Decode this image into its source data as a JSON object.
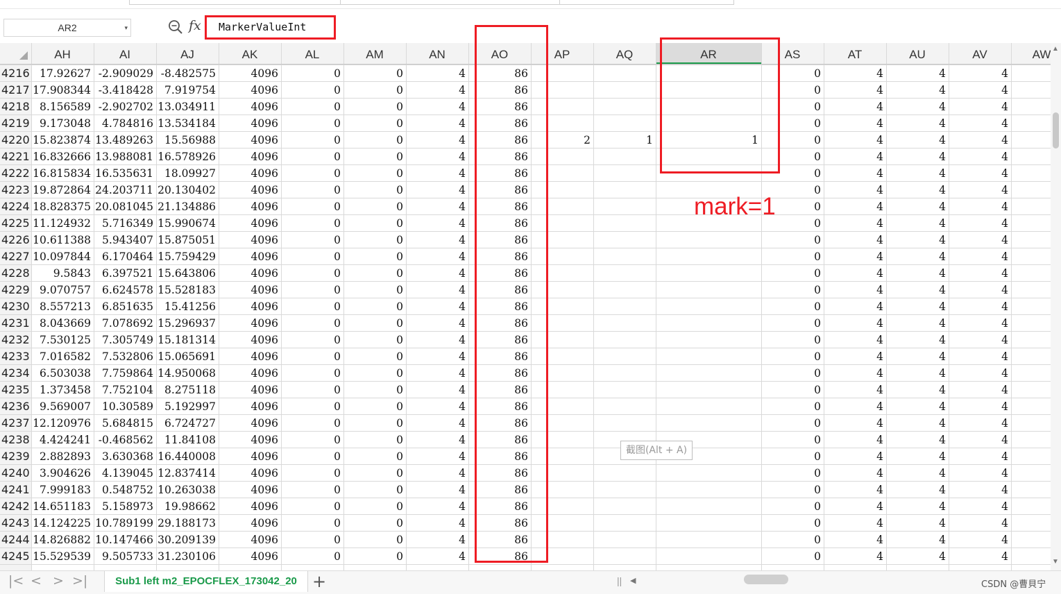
{
  "name_box": {
    "value": "AR2"
  },
  "formula_bar": {
    "fx_label": "fx",
    "content": "MarkerValueInt"
  },
  "columns": [
    "AH",
    "AI",
    "AJ",
    "AK",
    "AL",
    "AM",
    "AN",
    "AO",
    "AP",
    "AQ",
    "AR",
    "AS",
    "AT",
    "AU",
    "AV",
    "AW"
  ],
  "selected_column": "AR",
  "rows": [
    {
      "n": "4216",
      "v": [
        "17.92627",
        "-2.909029",
        "-8.482575",
        "4096",
        "0",
        "0",
        "4",
        "86",
        "",
        "",
        "",
        "0",
        "4",
        "4",
        "4"
      ]
    },
    {
      "n": "4217",
      "v": [
        "17.908344",
        "-3.418428",
        "7.919754",
        "4096",
        "0",
        "0",
        "4",
        "86",
        "",
        "",
        "",
        "0",
        "4",
        "4",
        "4"
      ]
    },
    {
      "n": "4218",
      "v": [
        "8.156589",
        "-2.902702",
        "13.034911",
        "4096",
        "0",
        "0",
        "4",
        "86",
        "",
        "",
        "",
        "0",
        "4",
        "4",
        "4"
      ]
    },
    {
      "n": "4219",
      "v": [
        "9.173048",
        "4.784816",
        "13.534184",
        "4096",
        "0",
        "0",
        "4",
        "86",
        "",
        "",
        "",
        "0",
        "4",
        "4",
        "4"
      ]
    },
    {
      "n": "4220",
      "v": [
        "15.823874",
        "13.489263",
        "15.56988",
        "4096",
        "0",
        "0",
        "4",
        "86",
        "2",
        "1",
        "1",
        "0",
        "4",
        "4",
        "4"
      ]
    },
    {
      "n": "4221",
      "v": [
        "16.832666",
        "13.988081",
        "16.578926",
        "4096",
        "0",
        "0",
        "4",
        "86",
        "",
        "",
        "",
        "0",
        "4",
        "4",
        "4"
      ]
    },
    {
      "n": "4222",
      "v": [
        "16.815834",
        "16.535631",
        "18.09927",
        "4096",
        "0",
        "0",
        "4",
        "86",
        "",
        "",
        "",
        "0",
        "4",
        "4",
        "4"
      ]
    },
    {
      "n": "4223",
      "v": [
        "19.872864",
        "24.203711",
        "20.130402",
        "4096",
        "0",
        "0",
        "4",
        "86",
        "",
        "",
        "",
        "0",
        "4",
        "4",
        "4"
      ]
    },
    {
      "n": "4224",
      "v": [
        "18.828375",
        "20.081045",
        "21.134886",
        "4096",
        "0",
        "0",
        "4",
        "86",
        "",
        "",
        "",
        "0",
        "4",
        "4",
        "4"
      ]
    },
    {
      "n": "4225",
      "v": [
        "11.124932",
        "5.716349",
        "15.990674",
        "4096",
        "0",
        "0",
        "4",
        "86",
        "",
        "",
        "",
        "0",
        "4",
        "4",
        "4"
      ]
    },
    {
      "n": "4226",
      "v": [
        "10.611388",
        "5.943407",
        "15.875051",
        "4096",
        "0",
        "0",
        "4",
        "86",
        "",
        "",
        "",
        "0",
        "4",
        "4",
        "4"
      ]
    },
    {
      "n": "4227",
      "v": [
        "10.097844",
        "6.170464",
        "15.759429",
        "4096",
        "0",
        "0",
        "4",
        "86",
        "",
        "",
        "",
        "0",
        "4",
        "4",
        "4"
      ]
    },
    {
      "n": "4228",
      "v": [
        "9.5843",
        "6.397521",
        "15.643806",
        "4096",
        "0",
        "0",
        "4",
        "86",
        "",
        "",
        "",
        "0",
        "4",
        "4",
        "4"
      ]
    },
    {
      "n": "4229",
      "v": [
        "9.070757",
        "6.624578",
        "15.528183",
        "4096",
        "0",
        "0",
        "4",
        "86",
        "",
        "",
        "",
        "0",
        "4",
        "4",
        "4"
      ]
    },
    {
      "n": "4230",
      "v": [
        "8.557213",
        "6.851635",
        "15.41256",
        "4096",
        "0",
        "0",
        "4",
        "86",
        "",
        "",
        "",
        "0",
        "4",
        "4",
        "4"
      ]
    },
    {
      "n": "4231",
      "v": [
        "8.043669",
        "7.078692",
        "15.296937",
        "4096",
        "0",
        "0",
        "4",
        "86",
        "",
        "",
        "",
        "0",
        "4",
        "4",
        "4"
      ]
    },
    {
      "n": "4232",
      "v": [
        "7.530125",
        "7.305749",
        "15.181314",
        "4096",
        "0",
        "0",
        "4",
        "86",
        "",
        "",
        "",
        "0",
        "4",
        "4",
        "4"
      ]
    },
    {
      "n": "4233",
      "v": [
        "7.016582",
        "7.532806",
        "15.065691",
        "4096",
        "0",
        "0",
        "4",
        "86",
        "",
        "",
        "",
        "0",
        "4",
        "4",
        "4"
      ]
    },
    {
      "n": "4234",
      "v": [
        "6.503038",
        "7.759864",
        "14.950068",
        "4096",
        "0",
        "0",
        "4",
        "86",
        "",
        "",
        "",
        "0",
        "4",
        "4",
        "4"
      ]
    },
    {
      "n": "4235",
      "v": [
        "1.373458",
        "7.752104",
        "8.275118",
        "4096",
        "0",
        "0",
        "4",
        "86",
        "",
        "",
        "",
        "0",
        "4",
        "4",
        "4"
      ]
    },
    {
      "n": "4236",
      "v": [
        "9.569007",
        "10.30589",
        "5.192997",
        "4096",
        "0",
        "0",
        "4",
        "86",
        "",
        "",
        "",
        "0",
        "4",
        "4",
        "4"
      ]
    },
    {
      "n": "4237",
      "v": [
        "12.120976",
        "5.684815",
        "6.724727",
        "4096",
        "0",
        "0",
        "4",
        "86",
        "",
        "",
        "",
        "0",
        "4",
        "4",
        "4"
      ]
    },
    {
      "n": "4238",
      "v": [
        "4.424241",
        "-0.468562",
        "11.84108",
        "4096",
        "0",
        "0",
        "4",
        "86",
        "",
        "",
        "",
        "0",
        "4",
        "4",
        "4"
      ]
    },
    {
      "n": "4239",
      "v": [
        "2.882893",
        "3.630368",
        "16.440008",
        "4096",
        "0",
        "0",
        "4",
        "86",
        "",
        "",
        "",
        "0",
        "4",
        "4",
        "4"
      ]
    },
    {
      "n": "4240",
      "v": [
        "3.904626",
        "4.139045",
        "12.837414",
        "4096",
        "0",
        "0",
        "4",
        "86",
        "",
        "",
        "",
        "0",
        "4",
        "4",
        "4"
      ]
    },
    {
      "n": "4241",
      "v": [
        "7.999183",
        "0.548752",
        "10.263038",
        "4096",
        "0",
        "0",
        "4",
        "86",
        "",
        "",
        "",
        "0",
        "4",
        "4",
        "4"
      ]
    },
    {
      "n": "4242",
      "v": [
        "14.651183",
        "5.158973",
        "19.98662",
        "4096",
        "0",
        "0",
        "4",
        "86",
        "",
        "",
        "",
        "0",
        "4",
        "4",
        "4"
      ]
    },
    {
      "n": "4243",
      "v": [
        "14.124225",
        "10.789199",
        "29.188173",
        "4096",
        "0",
        "0",
        "4",
        "86",
        "",
        "",
        "",
        "0",
        "4",
        "4",
        "4"
      ]
    },
    {
      "n": "4244",
      "v": [
        "14.826882",
        "10.147466",
        "30.209139",
        "4096",
        "0",
        "0",
        "4",
        "86",
        "",
        "",
        "",
        "0",
        "4",
        "4",
        "4"
      ]
    },
    {
      "n": "4245",
      "v": [
        "15.529539",
        "9.505733",
        "31.230106",
        "4096",
        "0",
        "0",
        "4",
        "86",
        "",
        "",
        "",
        "0",
        "4",
        "4",
        "4"
      ]
    }
  ],
  "sheet_tab": {
    "label": "Sub1 left m2_EPOCFLEX_173042_20"
  },
  "tooltip": {
    "text": "截图(Alt + A)"
  },
  "annotation": {
    "text": "mark=1",
    "color": "#ee1c24"
  },
  "watermark": {
    "text": "CSDN @曹貝宁"
  },
  "colors": {
    "selected_header_text": "#1a9a4a",
    "selected_header_bg": "#dcdcdc",
    "header_bg": "#f3f3f3",
    "grid_line": "#d9d9d9"
  }
}
